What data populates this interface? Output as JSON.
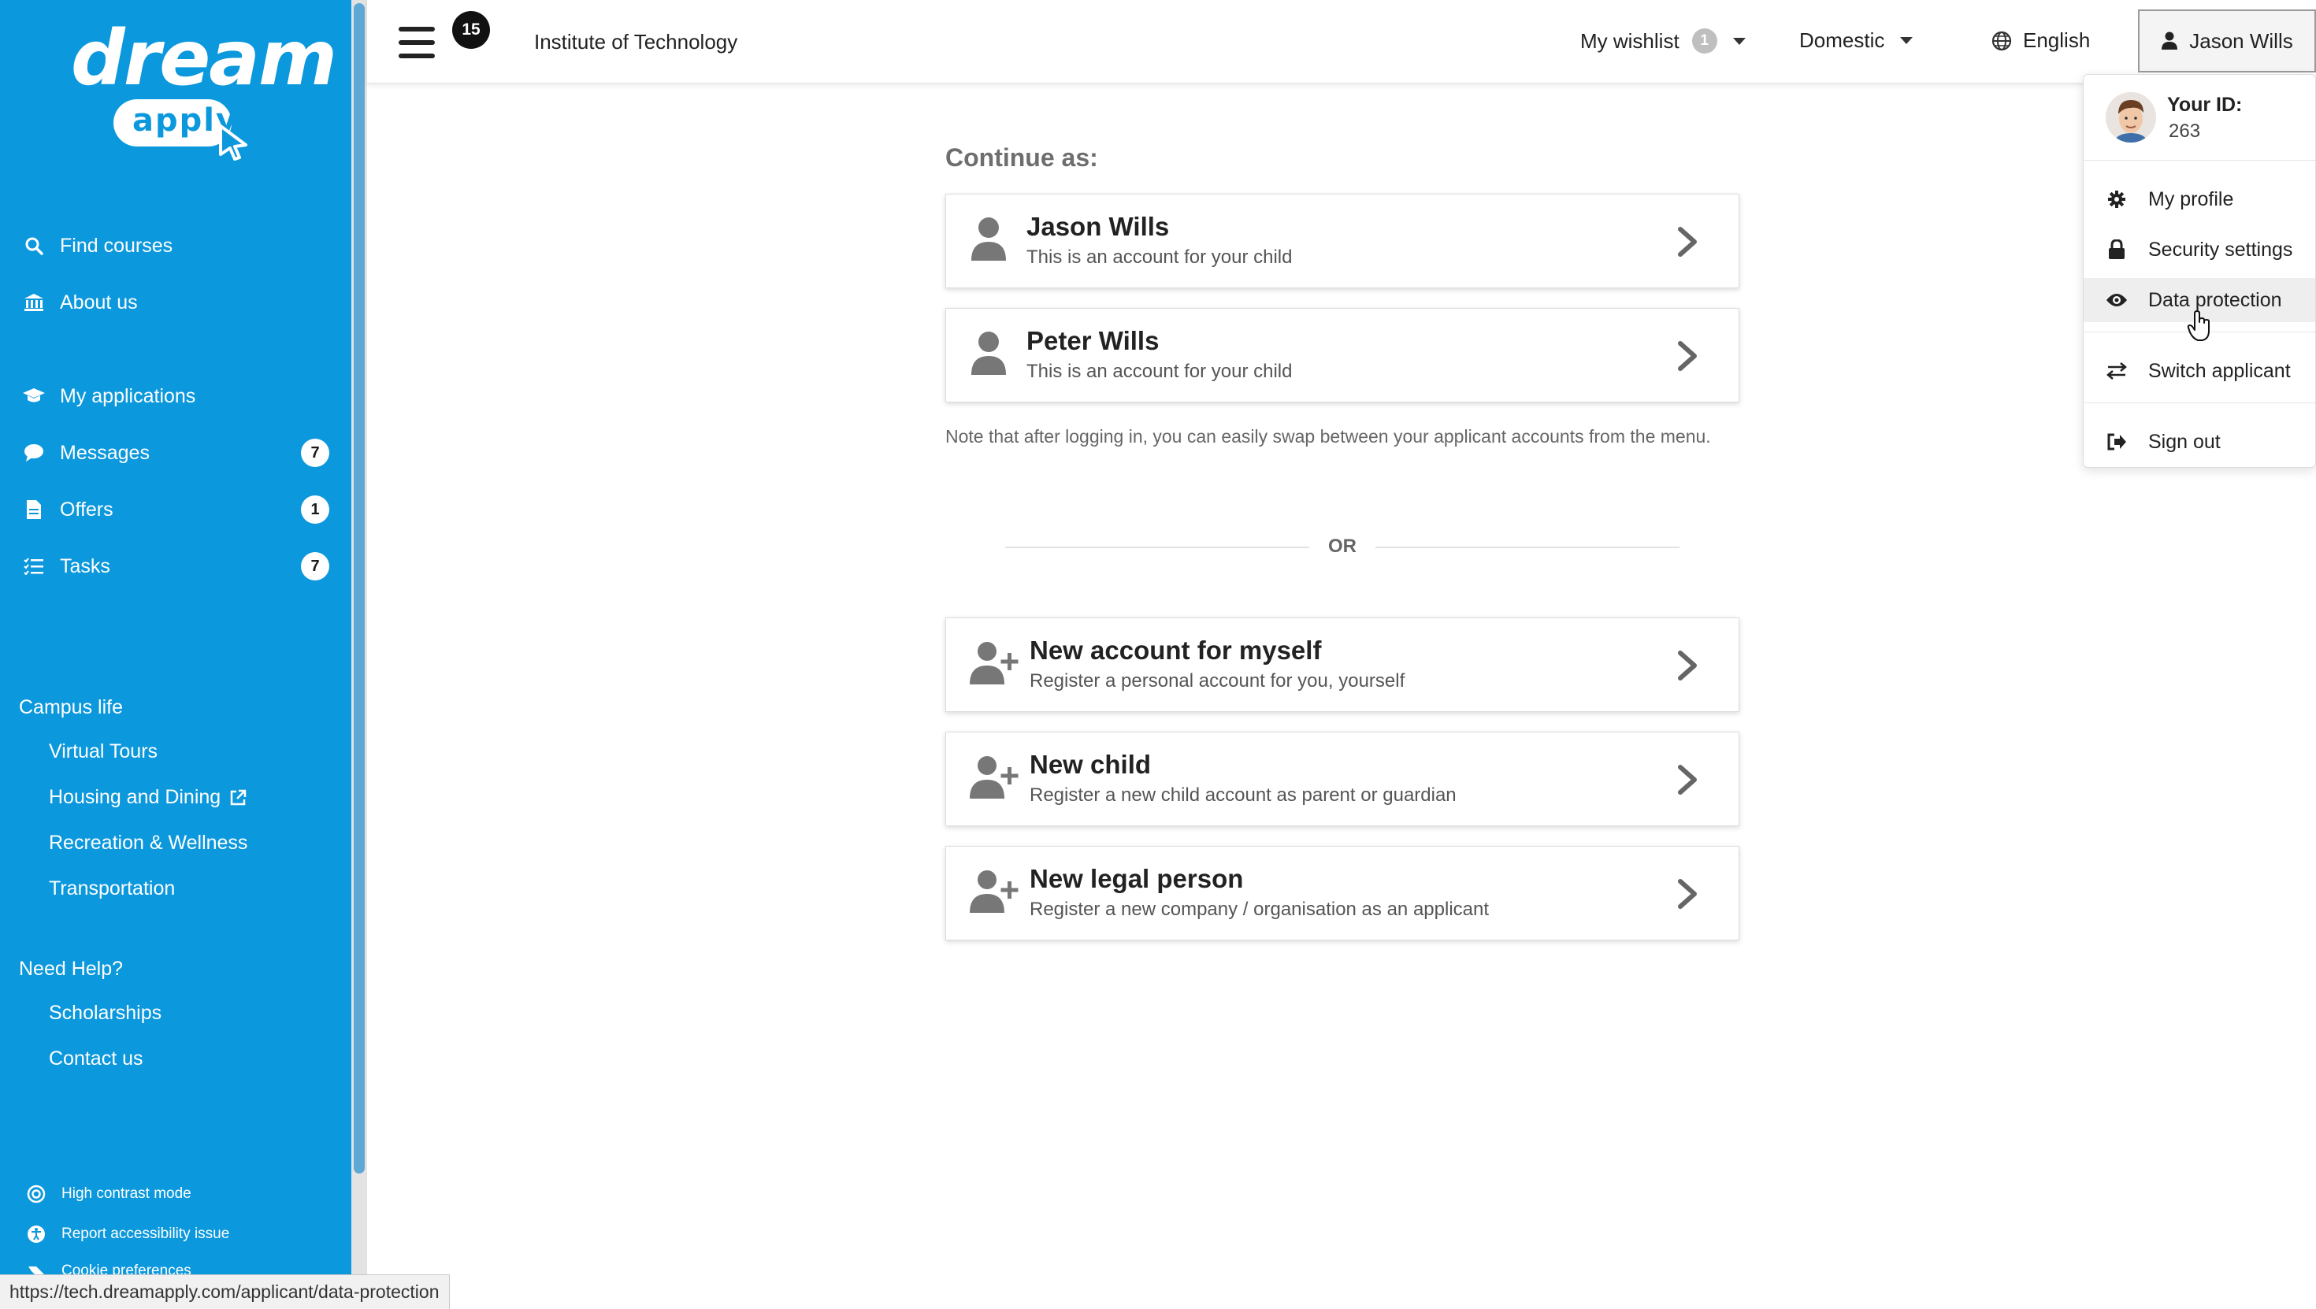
{
  "sidebar": {
    "logo": {
      "word": "dream",
      "pill": "apply"
    },
    "nav": [
      {
        "label": "Find courses"
      },
      {
        "label": "About us"
      },
      {
        "label": "My applications"
      },
      {
        "label": "Messages",
        "badge": "7"
      },
      {
        "label": "Offers",
        "badge": "1"
      },
      {
        "label": "Tasks",
        "badge": "7"
      }
    ],
    "campus": {
      "title": "Campus life",
      "links": [
        "Virtual Tours",
        "Housing and Dining",
        "Recreation & Wellness",
        "Transportation"
      ]
    },
    "help": {
      "title": "Need Help?",
      "links": [
        "Scholarships",
        "Contact us"
      ]
    },
    "footer": [
      "High contrast mode",
      "Report accessibility issue",
      "Cookie preferences"
    ]
  },
  "topbar": {
    "menu_badge": "15",
    "institution": "Institute of Technology",
    "wishlist_label": "My wishlist",
    "wishlist_count": "1",
    "region": "Domestic",
    "language": "English",
    "user": "Jason Wills"
  },
  "dropdown": {
    "id_label": "Your ID:",
    "id_value": "263",
    "items": [
      "My profile",
      "Security settings",
      "Data protection",
      "Switch applicant",
      "Sign out"
    ]
  },
  "main": {
    "continue_label": "Continue as:",
    "accounts": [
      {
        "name": "Jason Wills",
        "desc": "This is an account for your child"
      },
      {
        "name": "Peter Wills",
        "desc": "This is an account for your child"
      }
    ],
    "note": "Note that after logging in, you can easily swap between your applicant accounts from the menu.",
    "or": "OR",
    "new_options": [
      {
        "title": "New account for myself",
        "desc": "Register a personal account for you, yourself"
      },
      {
        "title": "New child",
        "desc": "Register a new child account as parent or guardian"
      },
      {
        "title": "New legal person",
        "desc": "Register a new company / organisation as an applicant"
      }
    ]
  },
  "status_url": "https://tech.dreamapply.com/applicant/data-protection",
  "colors": {
    "sidebar": "#0c98dc",
    "badge_dark": "#111111",
    "text": "#222222"
  }
}
